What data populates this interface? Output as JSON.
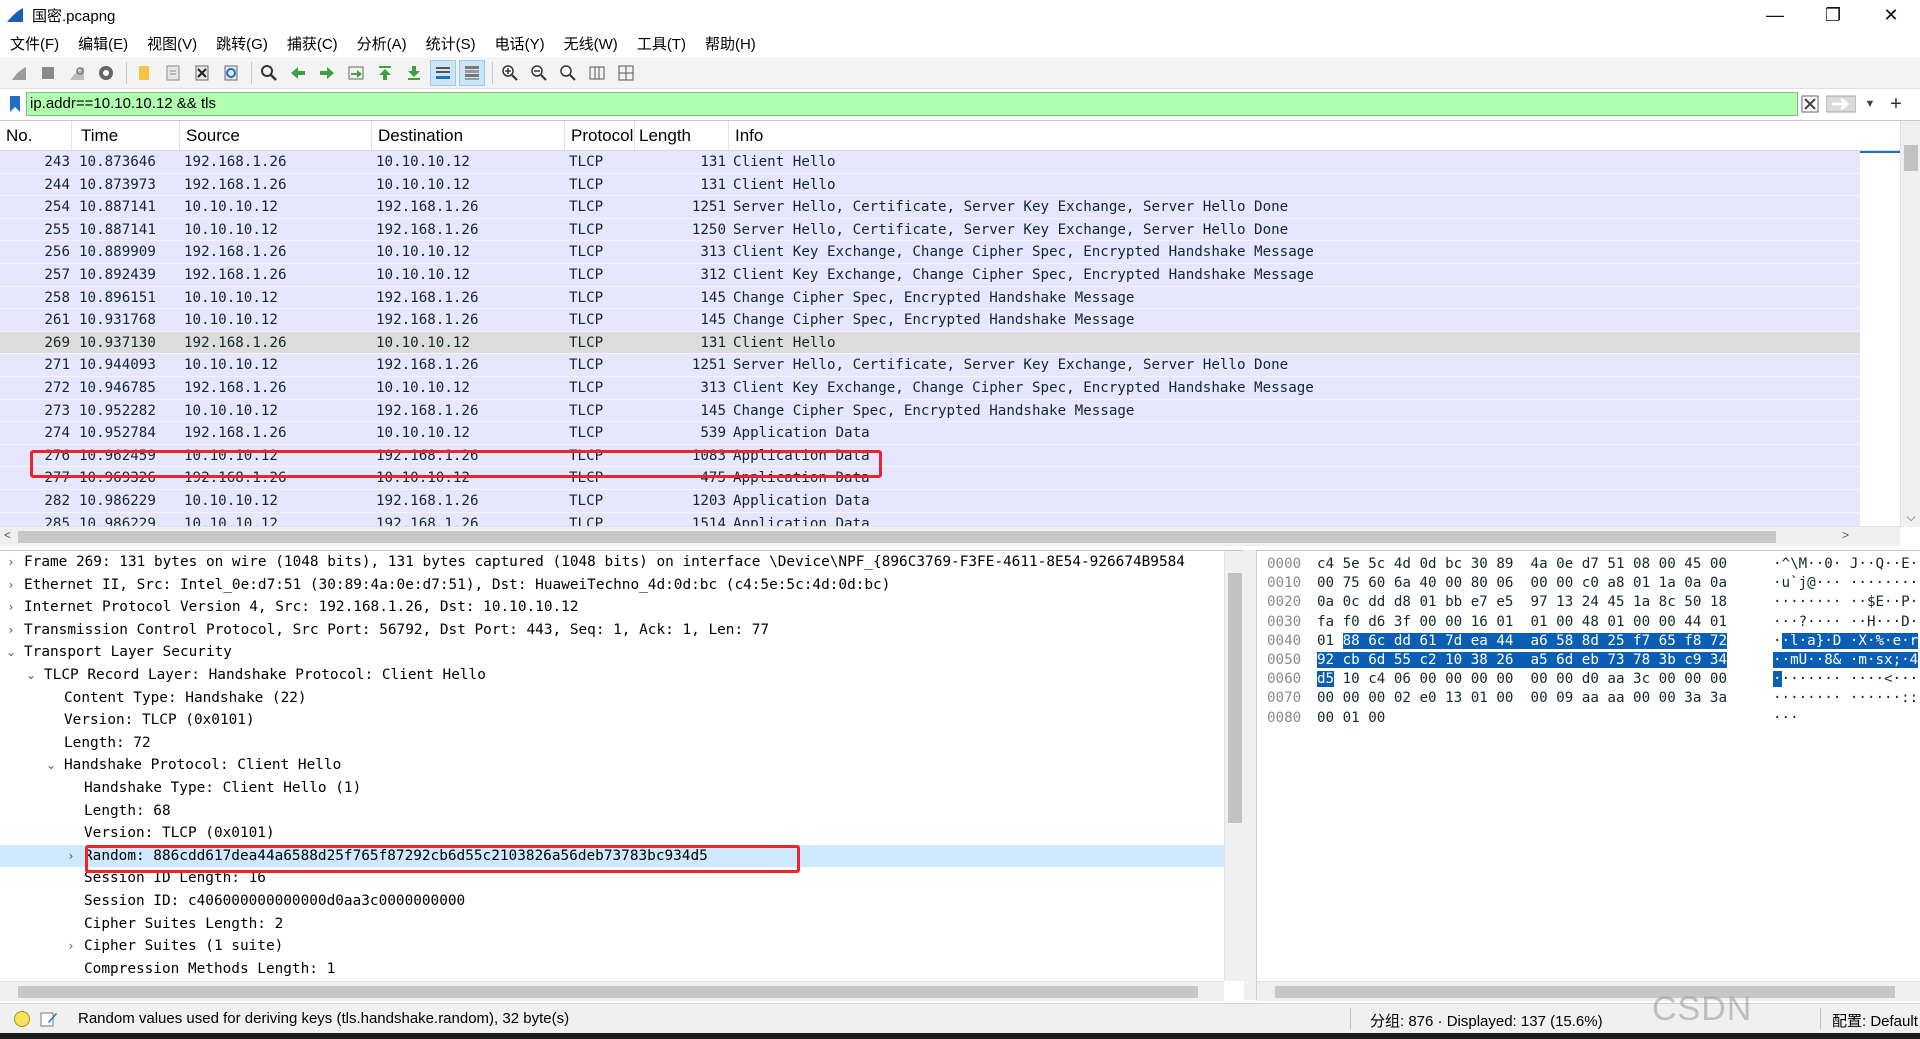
{
  "window": {
    "title": "国密.pcapng"
  },
  "menu": [
    "文件(F)",
    "编辑(E)",
    "视图(V)",
    "跳转(G)",
    "捕获(C)",
    "分析(A)",
    "统计(S)",
    "电话(Y)",
    "无线(W)",
    "工具(T)",
    "帮助(H)"
  ],
  "filter": {
    "value": "ip.addr==10.10.10.12 && tls"
  },
  "columns": [
    "No.",
    "Time",
    "Source",
    "Destination",
    "Protocol",
    "Length",
    "Info"
  ],
  "packets": [
    {
      "no": "243",
      "time": "10.873646",
      "src": "192.168.1.26",
      "dst": "10.10.10.12",
      "proto": "TLCP",
      "len": "131",
      "info": "Client Hello"
    },
    {
      "no": "244",
      "time": "10.873973",
      "src": "192.168.1.26",
      "dst": "10.10.10.12",
      "proto": "TLCP",
      "len": "131",
      "info": "Client Hello"
    },
    {
      "no": "254",
      "time": "10.887141",
      "src": "10.10.10.12",
      "dst": "192.168.1.26",
      "proto": "TLCP",
      "len": "1251",
      "info": "Server Hello, Certificate, Server Key Exchange, Server Hello Done"
    },
    {
      "no": "255",
      "time": "10.887141",
      "src": "10.10.10.12",
      "dst": "192.168.1.26",
      "proto": "TLCP",
      "len": "1250",
      "info": "Server Hello, Certificate, Server Key Exchange, Server Hello Done"
    },
    {
      "no": "256",
      "time": "10.889909",
      "src": "192.168.1.26",
      "dst": "10.10.10.12",
      "proto": "TLCP",
      "len": "313",
      "info": "Client Key Exchange, Change Cipher Spec, Encrypted Handshake Message"
    },
    {
      "no": "257",
      "time": "10.892439",
      "src": "192.168.1.26",
      "dst": "10.10.10.12",
      "proto": "TLCP",
      "len": "312",
      "info": "Client Key Exchange, Change Cipher Spec, Encrypted Handshake Message"
    },
    {
      "no": "258",
      "time": "10.896151",
      "src": "10.10.10.12",
      "dst": "192.168.1.26",
      "proto": "TLCP",
      "len": "145",
      "info": "Change Cipher Spec, Encrypted Handshake Message"
    },
    {
      "no": "261",
      "time": "10.931768",
      "src": "10.10.10.12",
      "dst": "192.168.1.26",
      "proto": "TLCP",
      "len": "145",
      "info": "Change Cipher Spec, Encrypted Handshake Message"
    },
    {
      "no": "269",
      "time": "10.937130",
      "src": "192.168.1.26",
      "dst": "10.10.10.12",
      "proto": "TLCP",
      "len": "131",
      "info": "Client Hello",
      "selected": true
    },
    {
      "no": "271",
      "time": "10.944093",
      "src": "10.10.10.12",
      "dst": "192.168.1.26",
      "proto": "TLCP",
      "len": "1251",
      "info": "Server Hello, Certificate, Server Key Exchange, Server Hello Done"
    },
    {
      "no": "272",
      "time": "10.946785",
      "src": "192.168.1.26",
      "dst": "10.10.10.12",
      "proto": "TLCP",
      "len": "313",
      "info": "Client Key Exchange, Change Cipher Spec, Encrypted Handshake Message"
    },
    {
      "no": "273",
      "time": "10.952282",
      "src": "10.10.10.12",
      "dst": "192.168.1.26",
      "proto": "TLCP",
      "len": "145",
      "info": "Change Cipher Spec, Encrypted Handshake Message"
    },
    {
      "no": "274",
      "time": "10.952784",
      "src": "192.168.1.26",
      "dst": "10.10.10.12",
      "proto": "TLCP",
      "len": "539",
      "info": "Application Data"
    },
    {
      "no": "276",
      "time": "10.962459",
      "src": "10.10.10.12",
      "dst": "192.168.1.26",
      "proto": "TLCP",
      "len": "1083",
      "info": "Application Data"
    },
    {
      "no": "277",
      "time": "10.969326",
      "src": "192.168.1.26",
      "dst": "10.10.10.12",
      "proto": "TLCP",
      "len": "475",
      "info": "Application Data"
    },
    {
      "no": "282",
      "time": "10.986229",
      "src": "10.10.10.12",
      "dst": "192.168.1.26",
      "proto": "TLCP",
      "len": "1203",
      "info": "Application Data"
    },
    {
      "no": "285",
      "time": "10.986229",
      "src": "10.10.10.12",
      "dst": "192.168.1.26",
      "proto": "TLCP",
      "len": "1514",
      "info": "Application Data"
    }
  ],
  "details": [
    {
      "level": 0,
      "arrow": "right",
      "text": "Frame 269: 131 bytes on wire (1048 bits), 131 bytes captured (1048 bits) on interface \\Device\\NPF_{896C3769-F3FE-4611-8E54-926674B9584"
    },
    {
      "level": 0,
      "arrow": "right",
      "text": "Ethernet II, Src: Intel_0e:d7:51 (30:89:4a:0e:d7:51), Dst: HuaweiTechno_4d:0d:bc (c4:5e:5c:4d:0d:bc)"
    },
    {
      "level": 0,
      "arrow": "right",
      "text": "Internet Protocol Version 4, Src: 192.168.1.26, Dst: 10.10.10.12"
    },
    {
      "level": 0,
      "arrow": "right",
      "text": "Transmission Control Protocol, Src Port: 56792, Dst Port: 443, Seq: 1, Ack: 1, Len: 77"
    },
    {
      "level": 0,
      "arrow": "down",
      "text": "Transport Layer Security"
    },
    {
      "level": 1,
      "arrow": "down",
      "text": "TLCP Record Layer: Handshake Protocol: Client Hello"
    },
    {
      "level": 2,
      "arrow": "",
      "text": "Content Type: Handshake (22)"
    },
    {
      "level": 2,
      "arrow": "",
      "text": "Version: TLCP (0x0101)"
    },
    {
      "level": 2,
      "arrow": "",
      "text": "Length: 72"
    },
    {
      "level": 2,
      "arrow": "down",
      "text": "Handshake Protocol: Client Hello"
    },
    {
      "level": 3,
      "arrow": "",
      "text": "Handshake Type: Client Hello (1)"
    },
    {
      "level": 3,
      "arrow": "",
      "text": "Length: 68"
    },
    {
      "level": 3,
      "arrow": "",
      "text": "Version: TLCP (0x0101)"
    },
    {
      "level": 3,
      "arrow": "right",
      "text": "Random: 886cdd617dea44a6588d25f765f87292cb6d55c2103826a56deb73783bc934d5",
      "selected": true
    },
    {
      "level": 3,
      "arrow": "",
      "text": "Session ID Length: 16"
    },
    {
      "level": 3,
      "arrow": "",
      "text": "Session ID: c406000000000000d0aa3c0000000000"
    },
    {
      "level": 3,
      "arrow": "",
      "text": "Cipher Suites Length: 2"
    },
    {
      "level": 3,
      "arrow": "right",
      "text": "Cipher Suites (1 suite)"
    },
    {
      "level": 3,
      "arrow": "",
      "text": "Compression Methods Length: 1"
    }
  ],
  "bytes": [
    {
      "off": "0000",
      "hex": [
        [
          "c4 5e 5c 4d 0d bc 30 89  4a 0e d7 51 08 00 45 00",
          ""
        ]
      ],
      "ascii": [
        [
          "·^\\M··0· J··Q··E·",
          ""
        ]
      ]
    },
    {
      "off": "0010",
      "hex": [
        [
          "00 75 60 6a 40 00 80 06  00 00 c0 a8 01 1a 0a 0a",
          ""
        ]
      ],
      "ascii": [
        [
          "·u`j@··· ········",
          ""
        ]
      ]
    },
    {
      "off": "0020",
      "hex": [
        [
          "0a 0c dd d8 01 bb e7 e5  97 13 24 45 1a 8c 50 18",
          ""
        ]
      ],
      "ascii": [
        [
          "········ ··$E··P·",
          ""
        ]
      ]
    },
    {
      "off": "0030",
      "hex": [
        [
          "fa f0 d6 3f 00 00 16 01  01 00 48 01 00 00 44 01",
          ""
        ]
      ],
      "ascii": [
        [
          "···?···· ··H···D·",
          ""
        ]
      ]
    },
    {
      "off": "0040",
      "hex": [
        [
          "01 ",
          ""
        ],
        [
          "88 6c dd 61 7d ea 44  a6 58 8d 25 f7 65 f8 72",
          "sel"
        ]
      ],
      "ascii": [
        [
          "·",
          ""
        ],
        [
          "·l·a}·D ·X·%·e·r",
          "sel"
        ]
      ]
    },
    {
      "off": "0050",
      "hex": [
        [
          "92 cb 6d 55 c2 10 38 26  a5 6d eb 73 78 3b c9 34",
          "sel"
        ]
      ],
      "ascii": [
        [
          "··mU··8& ·m·sx;·4",
          "sel"
        ]
      ]
    },
    {
      "off": "0060",
      "hex": [
        [
          "d5",
          "sel"
        ],
        [
          " 10 c4 06 00 00 00 00  00 00 d0 aa 3c 00 00 00",
          ""
        ]
      ],
      "ascii": [
        [
          "·",
          "sel"
        ],
        [
          "······· ····<···",
          ""
        ]
      ]
    },
    {
      "off": "0070",
      "hex": [
        [
          "00 00 00 02 e0 13 01 00  00 09 aa aa 00 00 3a 3a",
          ""
        ]
      ],
      "ascii": [
        [
          "········ ······::",
          ""
        ]
      ]
    },
    {
      "off": "0080",
      "hex": [
        [
          "00 01 00",
          ""
        ]
      ],
      "ascii": [
        [
          "···",
          ""
        ]
      ]
    }
  ],
  "status": {
    "message": "Random values used for deriving keys (tls.handshake.random), 32 byte(s)",
    "counts": "分组: 876 · Displayed: 137 (15.6%)",
    "profile": "配置: Default"
  },
  "watermark": "CSDN @ze_qian"
}
